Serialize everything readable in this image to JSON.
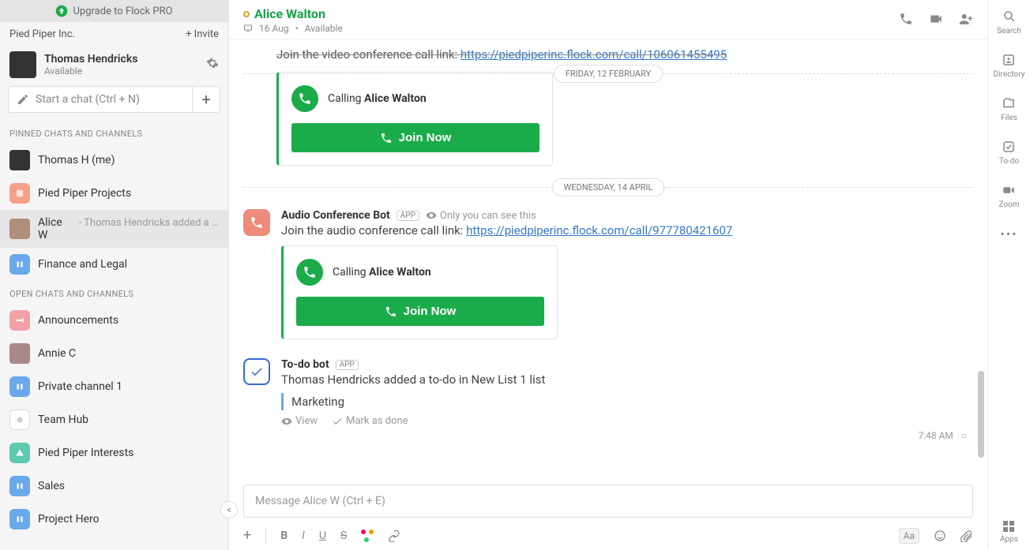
{
  "sidebar": {
    "upgrade": "Upgrade to Flock PRO",
    "org": "Pied Piper Inc.",
    "invite": "+ Invite",
    "user": {
      "name": "Thomas Hendricks",
      "status": "Available"
    },
    "newchat_placeholder": "Start a chat (Ctrl + N)",
    "pinned_label": "PINNED CHATS AND CHANNELS",
    "open_label": "OPEN CHATS AND CHANNELS",
    "pinned": [
      {
        "name": "Thomas H (me)"
      },
      {
        "name": "Pied Piper Projects"
      },
      {
        "name": "Alice W",
        "preview": "- Thomas Hendricks added a t…"
      },
      {
        "name": "Finance and Legal"
      }
    ],
    "open": [
      {
        "name": "Announcements"
      },
      {
        "name": "Annie C"
      },
      {
        "name": "Private channel 1"
      },
      {
        "name": "Team Hub"
      },
      {
        "name": "Pied Piper Interests"
      },
      {
        "name": "Sales"
      },
      {
        "name": "Project Hero"
      }
    ]
  },
  "header": {
    "title": "Alice Walton",
    "date": "16 Aug",
    "status": "Available"
  },
  "messages": {
    "truncated_prefix": "Join the video conference call link: ",
    "truncated_link": "https://piedpiperinc.flock.com/call/106061455495",
    "date1": "FRIDAY, 12 FEBRUARY",
    "date2": "WEDNESDAY, 14 APRIL",
    "call1": {
      "calling_prefix": "Calling ",
      "calling_name": "Alice Walton",
      "join": "Join Now"
    },
    "audio_bot": {
      "sender": "Audio Conference Bot",
      "badge": "APP",
      "visibility": "Only you can see this",
      "text_prefix": "Join the audio conference call link: ",
      "link": "https://piedpiperinc.flock.com/call/977780421607",
      "calling_prefix": "Calling ",
      "calling_name": "Alice Walton",
      "join": "Join Now"
    },
    "todo_bot": {
      "sender": "To-do bot",
      "badge": "APP",
      "text": "Thomas Hendricks added a to-do in New List 1 list",
      "item": "Marketing",
      "view": "View",
      "done": "Mark as done",
      "time": "7:48 AM"
    }
  },
  "composer": {
    "placeholder": "Message Alice W (Ctrl + E)",
    "aa": "Aa"
  },
  "rightbar": {
    "search": "Search",
    "directory": "Directory",
    "files": "Files",
    "todo": "To-do",
    "zoom": "Zoom",
    "apps": "Apps"
  }
}
